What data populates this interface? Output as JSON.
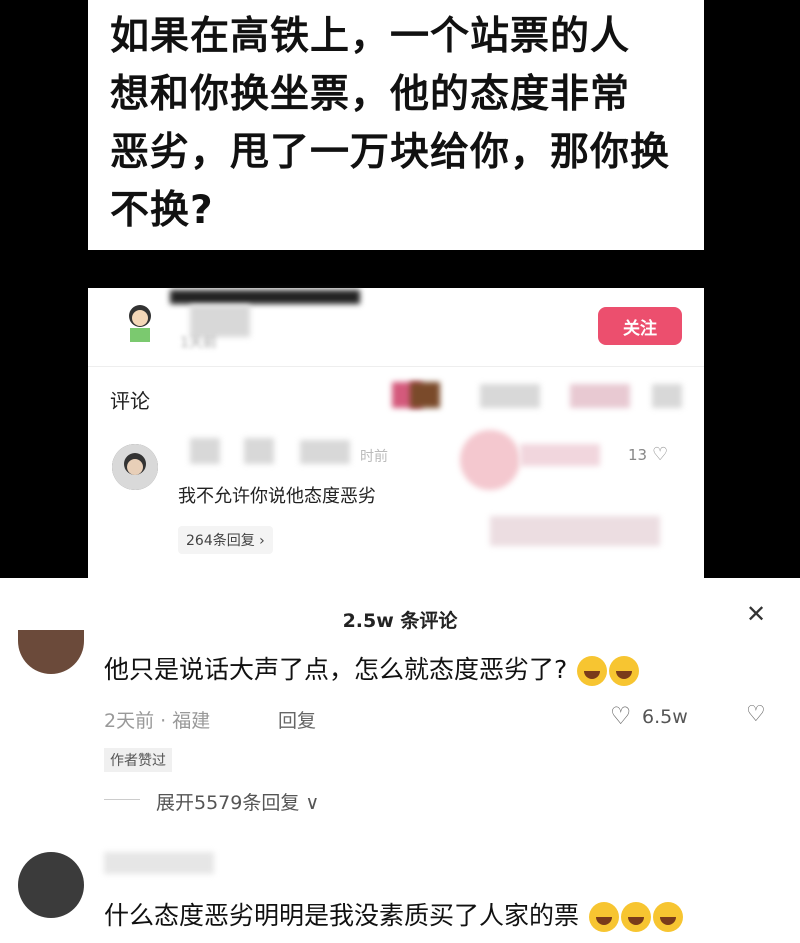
{
  "question": {
    "line1": "如果在高铁上，一个站票的人",
    "line2": "想和你换坐票，他的态度非常",
    "line3": "恶劣，甩了一万块给你，那你换",
    "line4": "不换?"
  },
  "post": {
    "meta": "1天前",
    "follow_label": "关注",
    "comments_tab": "评论",
    "comment1": {
      "time": "时前",
      "likes": "13",
      "text": "我不允许你说他态度恶劣",
      "replies": "264条回复 ›"
    }
  },
  "sheet": {
    "header": "2.5w 条评论",
    "comment1": {
      "text": "他只是说话大声了点，怎么就态度恶劣了?",
      "meta": "2天前 · 福建",
      "reply_label": "回复",
      "likes": "6.5w",
      "badge": "作者赞过",
      "expand": "展开5579条回复 ∨"
    },
    "comment2": {
      "text": "什么态度恶劣明明是我没素质买了人家的票"
    }
  },
  "icons": {
    "close": "close-icon",
    "like": "heart-icon",
    "dislike": "broken-heart-icon"
  }
}
